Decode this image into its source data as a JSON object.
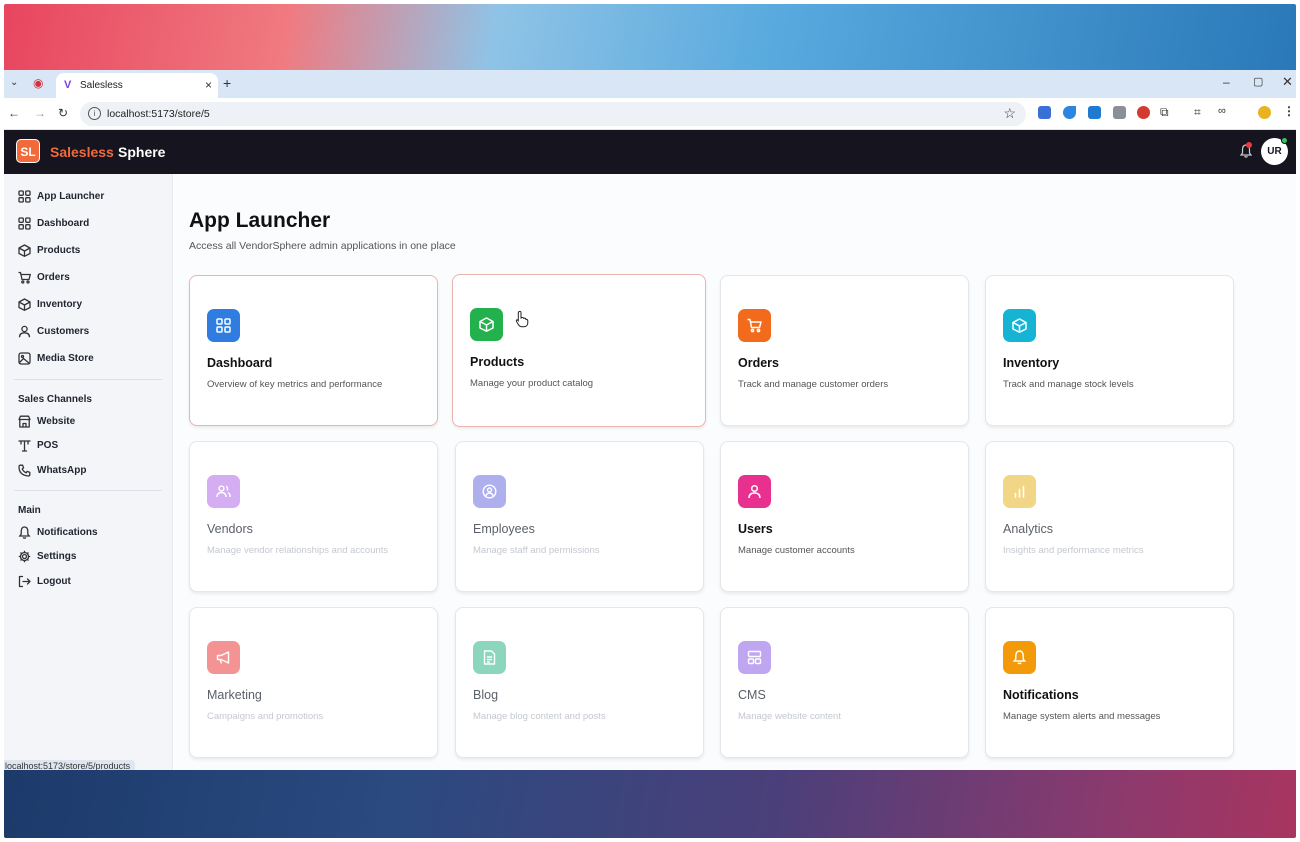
{
  "browser": {
    "tab_title": "Salesless",
    "url": "localhost:5173/store/5",
    "status_url": "localhost:5173/store/5/products",
    "colors": {
      "tabbar": "#d9e6f5"
    }
  },
  "header": {
    "badge": "SL",
    "brand_a": "Salesless",
    "brand_b": "Sphere",
    "avatar": "UR",
    "colors": {
      "bg": "#15141f",
      "accent": "#f26a3a"
    }
  },
  "sidebar": {
    "items": [
      {
        "label": "App Launcher",
        "icon": "grid-icon"
      },
      {
        "label": "Dashboard",
        "icon": "grid-icon"
      },
      {
        "label": "Products",
        "icon": "box-icon"
      },
      {
        "label": "Orders",
        "icon": "cart-icon"
      },
      {
        "label": "Inventory",
        "icon": "box-icon"
      },
      {
        "label": "Customers",
        "icon": "user-icon"
      },
      {
        "label": "Media Store",
        "icon": "image-icon"
      }
    ],
    "sales_channels_title": "Sales Channels",
    "channels": [
      {
        "label": "Website",
        "icon": "store-icon"
      },
      {
        "label": "POS",
        "icon": "pos-icon"
      },
      {
        "label": "WhatsApp",
        "icon": "phone-icon"
      }
    ],
    "main_title": "Main",
    "main_items": [
      {
        "label": "Notifications",
        "icon": "bell-icon"
      },
      {
        "label": "Settings",
        "icon": "gear-icon"
      },
      {
        "label": "Logout",
        "icon": "logout-icon"
      }
    ]
  },
  "main": {
    "title": "App Launcher",
    "subtitle": "Access all VendorSphere admin applications in one place",
    "cards": [
      {
        "title": "Dashboard",
        "desc": "Overview of key metrics and performance",
        "icon": "grid-icon",
        "color": "#2f7de1"
      },
      {
        "title": "Products",
        "desc": "Manage your product catalog",
        "icon": "box-icon",
        "color": "#22b14c"
      },
      {
        "title": "Orders",
        "desc": "Track and manage customer orders",
        "icon": "cart-icon",
        "color": "#f26a1b"
      },
      {
        "title": "Inventory",
        "desc": "Track and manage stock levels",
        "icon": "box-icon",
        "color": "#16b4d4"
      },
      {
        "title": "Vendors",
        "desc": "Manage vendor relationships and accounts",
        "icon": "users-icon",
        "color": "#b26be8"
      },
      {
        "title": "Employees",
        "desc": "Manage staff and permissions",
        "icon": "user-circle-icon",
        "color": "#6e6ee0"
      },
      {
        "title": "Users",
        "desc": "Manage customer accounts",
        "icon": "user-icon",
        "color": "#e8308f"
      },
      {
        "title": "Analytics",
        "desc": "Insights and performance metrics",
        "icon": "chart-icon",
        "color": "#e8b627"
      },
      {
        "title": "Marketing",
        "desc": "Campaigns and promotions",
        "icon": "megaphone-icon",
        "color": "#ec3b3b"
      },
      {
        "title": "Blog",
        "desc": "Manage blog content and posts",
        "icon": "document-icon",
        "color": "#2fb58a"
      },
      {
        "title": "CMS",
        "desc": "Manage website content",
        "icon": "layout-icon",
        "color": "#8e5ee6"
      },
      {
        "title": "Notifications",
        "desc": "Manage system alerts and messages",
        "icon": "bell-icon",
        "color": "#f39a0b"
      }
    ]
  }
}
